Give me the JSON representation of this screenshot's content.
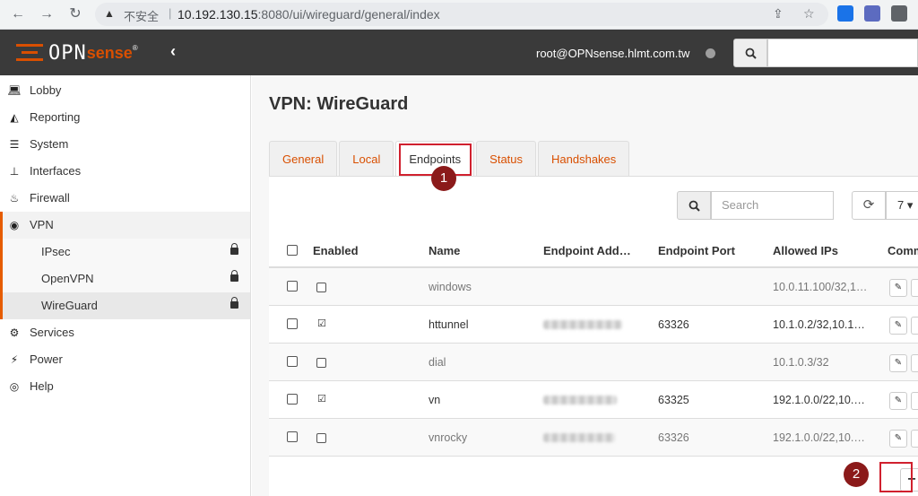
{
  "browser": {
    "back": "←",
    "forward": "→",
    "reload": "↻",
    "security_icon": "warning-triangle-icon",
    "insecure_label": "不安全",
    "url_host": "10.192.130.15",
    "url_path": ":8080/ui/wireguard/general/index"
  },
  "header": {
    "logo_text": "OPN",
    "logo_text2": "sense",
    "logo_reg": "®",
    "collapse": "‹",
    "user": "root@OPNsense.hlmt.com.tw"
  },
  "sidebar": {
    "items": [
      {
        "label": "Lobby",
        "icon": "laptop-icon"
      },
      {
        "label": "Reporting",
        "icon": "area-chart-icon"
      },
      {
        "label": "System",
        "icon": "server-icon"
      },
      {
        "label": "Interfaces",
        "icon": "sitemap-icon"
      },
      {
        "label": "Firewall",
        "icon": "fire-icon"
      },
      {
        "label": "VPN",
        "icon": "globe-icon"
      },
      {
        "label": "Services",
        "icon": "cog-icon"
      },
      {
        "label": "Power",
        "icon": "plug-icon"
      },
      {
        "label": "Help",
        "icon": "lifebuoy-icon"
      }
    ],
    "vpn_sub": [
      {
        "label": "IPsec"
      },
      {
        "label": "OpenVPN"
      },
      {
        "label": "WireGuard"
      }
    ]
  },
  "main": {
    "title": "VPN: WireGuard",
    "tabs": [
      "General",
      "Local",
      "Endpoints",
      "Status",
      "Handshakes"
    ],
    "search_placeholder": "Search",
    "page_size": "7 ▾",
    "columns": [
      "Enabled",
      "Name",
      "Endpoint Add…",
      "Endpoint Port",
      "Allowed IPs",
      "Comm"
    ],
    "rows": [
      {
        "enabled": false,
        "name": "windows",
        "endpoint": "",
        "port": "",
        "allowed": "10.0.11.100/32,1…",
        "muted": true
      },
      {
        "enabled": true,
        "name": "httunnel",
        "endpoint": "redacted",
        "port": "63326",
        "allowed": "10.1.0.2/32,10.1…",
        "muted": false
      },
      {
        "enabled": false,
        "name": "dial",
        "endpoint": "",
        "port": "",
        "allowed": "10.1.0.3/32",
        "muted": true
      },
      {
        "enabled": true,
        "name": "vn",
        "endpoint": "redacted",
        "port": "63325",
        "allowed": "192.1.0.0/22,10.…",
        "muted": false
      },
      {
        "enabled": false,
        "name": "vnrocky",
        "endpoint": "redacted",
        "port": "63326",
        "allowed": "192.1.0.0/22,10.…",
        "muted": true
      }
    ],
    "add": "+"
  },
  "annotations": {
    "badge1": "1",
    "badge2": "2",
    "color": "#d0202e"
  }
}
